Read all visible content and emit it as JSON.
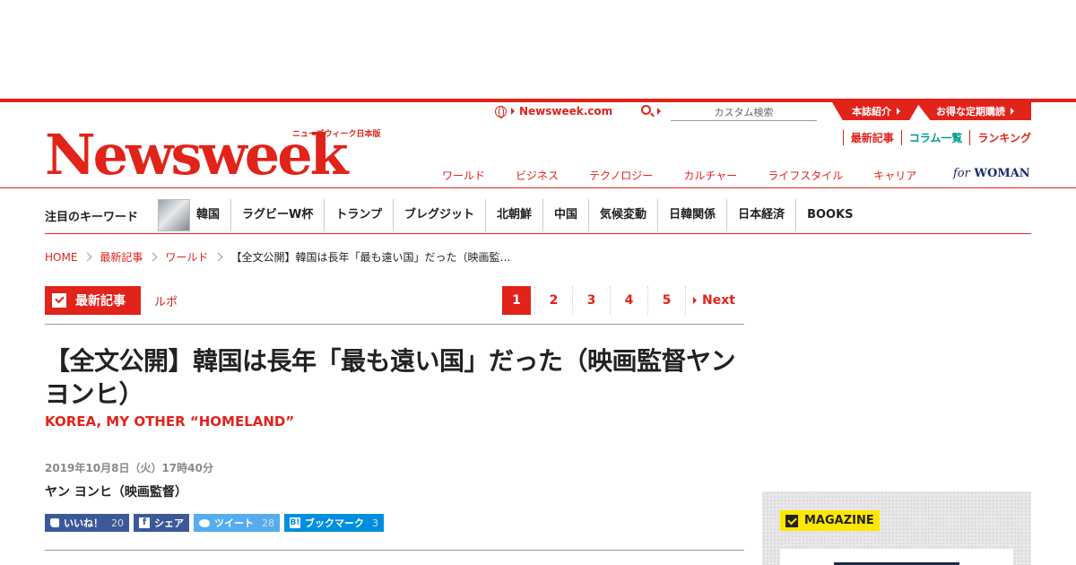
{
  "header": {
    "logo_text": "Newsweek",
    "logo_sub": "ニューズウィーク日本版",
    "site_link": "Newsweek.com",
    "search_placeholder": "カスタム検索",
    "tabs": [
      "本誌紹介",
      "お得な定期購読"
    ],
    "sublinks": [
      "最新記事",
      "コラム一覧",
      "ランキング"
    ],
    "categories": [
      "ワールド",
      "ビジネス",
      "テクノロジー",
      "カルチャー",
      "ライフスタイル",
      "キャリア"
    ],
    "for_woman": {
      "for": "for",
      "woman": "WOMAN"
    }
  },
  "keywords": {
    "label": "注目のキーワード",
    "items": [
      "韓国",
      "ラグビーW杯",
      "トランプ",
      "ブレグジット",
      "北朝鮮",
      "中国",
      "気候変動",
      "日韓関係",
      "日本経済",
      "BOOKS"
    ]
  },
  "breadcrumb": [
    "HOME",
    "最新記事",
    "ワールド",
    "【全文公開】韓国は長年「最も遠い国」だった（映画監…"
  ],
  "section": {
    "tag": "最新記事",
    "category": "ルポ"
  },
  "pager": {
    "pages": [
      "1",
      "2",
      "3",
      "4",
      "5"
    ],
    "active": "1",
    "next": "Next"
  },
  "article": {
    "title": "【全文公開】韓国は長年「最も遠い国」だった（映画監督ヤン ヨンヒ）",
    "subtitle": "KOREA, MY OTHER “HOMELAND”",
    "date": "2019年10月8日（火）17時40分",
    "author": "ヤン ヨンヒ（映画監督）"
  },
  "social": {
    "like": {
      "label": "いいね！",
      "count": "20"
    },
    "share": {
      "label": "シェア"
    },
    "tweet": {
      "label": "ツイート",
      "count": "28"
    },
    "bookmark": {
      "label": "ブックマーク",
      "count": "3"
    }
  },
  "sidebar": {
    "magazine_label": "MAGAZINE"
  },
  "colors": {
    "brand_red": "#e2231a",
    "facebook": "#3b5998",
    "twitter": "#55acee",
    "hatena": "#008fde",
    "magazine_yellow": "#ffe600"
  }
}
